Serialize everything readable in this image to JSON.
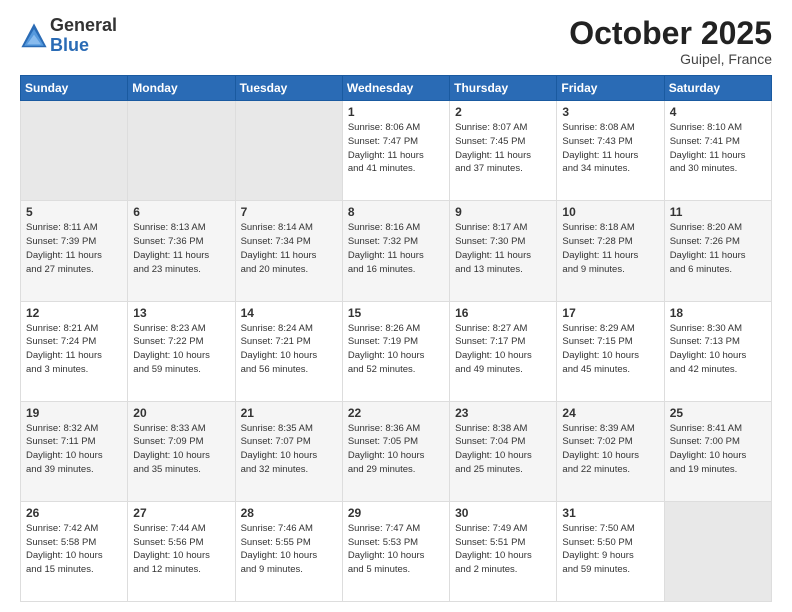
{
  "header": {
    "logo_general": "General",
    "logo_blue": "Blue",
    "month_title": "October 2025",
    "location": "Guipel, France"
  },
  "days_of_week": [
    "Sunday",
    "Monday",
    "Tuesday",
    "Wednesday",
    "Thursday",
    "Friday",
    "Saturday"
  ],
  "weeks": [
    [
      {
        "num": "",
        "info": ""
      },
      {
        "num": "",
        "info": ""
      },
      {
        "num": "",
        "info": ""
      },
      {
        "num": "1",
        "info": "Sunrise: 8:06 AM\nSunset: 7:47 PM\nDaylight: 11 hours\nand 41 minutes."
      },
      {
        "num": "2",
        "info": "Sunrise: 8:07 AM\nSunset: 7:45 PM\nDaylight: 11 hours\nand 37 minutes."
      },
      {
        "num": "3",
        "info": "Sunrise: 8:08 AM\nSunset: 7:43 PM\nDaylight: 11 hours\nand 34 minutes."
      },
      {
        "num": "4",
        "info": "Sunrise: 8:10 AM\nSunset: 7:41 PM\nDaylight: 11 hours\nand 30 minutes."
      }
    ],
    [
      {
        "num": "5",
        "info": "Sunrise: 8:11 AM\nSunset: 7:39 PM\nDaylight: 11 hours\nand 27 minutes."
      },
      {
        "num": "6",
        "info": "Sunrise: 8:13 AM\nSunset: 7:36 PM\nDaylight: 11 hours\nand 23 minutes."
      },
      {
        "num": "7",
        "info": "Sunrise: 8:14 AM\nSunset: 7:34 PM\nDaylight: 11 hours\nand 20 minutes."
      },
      {
        "num": "8",
        "info": "Sunrise: 8:16 AM\nSunset: 7:32 PM\nDaylight: 11 hours\nand 16 minutes."
      },
      {
        "num": "9",
        "info": "Sunrise: 8:17 AM\nSunset: 7:30 PM\nDaylight: 11 hours\nand 13 minutes."
      },
      {
        "num": "10",
        "info": "Sunrise: 8:18 AM\nSunset: 7:28 PM\nDaylight: 11 hours\nand 9 minutes."
      },
      {
        "num": "11",
        "info": "Sunrise: 8:20 AM\nSunset: 7:26 PM\nDaylight: 11 hours\nand 6 minutes."
      }
    ],
    [
      {
        "num": "12",
        "info": "Sunrise: 8:21 AM\nSunset: 7:24 PM\nDaylight: 11 hours\nand 3 minutes."
      },
      {
        "num": "13",
        "info": "Sunrise: 8:23 AM\nSunset: 7:22 PM\nDaylight: 10 hours\nand 59 minutes."
      },
      {
        "num": "14",
        "info": "Sunrise: 8:24 AM\nSunset: 7:21 PM\nDaylight: 10 hours\nand 56 minutes."
      },
      {
        "num": "15",
        "info": "Sunrise: 8:26 AM\nSunset: 7:19 PM\nDaylight: 10 hours\nand 52 minutes."
      },
      {
        "num": "16",
        "info": "Sunrise: 8:27 AM\nSunset: 7:17 PM\nDaylight: 10 hours\nand 49 minutes."
      },
      {
        "num": "17",
        "info": "Sunrise: 8:29 AM\nSunset: 7:15 PM\nDaylight: 10 hours\nand 45 minutes."
      },
      {
        "num": "18",
        "info": "Sunrise: 8:30 AM\nSunset: 7:13 PM\nDaylight: 10 hours\nand 42 minutes."
      }
    ],
    [
      {
        "num": "19",
        "info": "Sunrise: 8:32 AM\nSunset: 7:11 PM\nDaylight: 10 hours\nand 39 minutes."
      },
      {
        "num": "20",
        "info": "Sunrise: 8:33 AM\nSunset: 7:09 PM\nDaylight: 10 hours\nand 35 minutes."
      },
      {
        "num": "21",
        "info": "Sunrise: 8:35 AM\nSunset: 7:07 PM\nDaylight: 10 hours\nand 32 minutes."
      },
      {
        "num": "22",
        "info": "Sunrise: 8:36 AM\nSunset: 7:05 PM\nDaylight: 10 hours\nand 29 minutes."
      },
      {
        "num": "23",
        "info": "Sunrise: 8:38 AM\nSunset: 7:04 PM\nDaylight: 10 hours\nand 25 minutes."
      },
      {
        "num": "24",
        "info": "Sunrise: 8:39 AM\nSunset: 7:02 PM\nDaylight: 10 hours\nand 22 minutes."
      },
      {
        "num": "25",
        "info": "Sunrise: 8:41 AM\nSunset: 7:00 PM\nDaylight: 10 hours\nand 19 minutes."
      }
    ],
    [
      {
        "num": "26",
        "info": "Sunrise: 7:42 AM\nSunset: 5:58 PM\nDaylight: 10 hours\nand 15 minutes."
      },
      {
        "num": "27",
        "info": "Sunrise: 7:44 AM\nSunset: 5:56 PM\nDaylight: 10 hours\nand 12 minutes."
      },
      {
        "num": "28",
        "info": "Sunrise: 7:46 AM\nSunset: 5:55 PM\nDaylight: 10 hours\nand 9 minutes."
      },
      {
        "num": "29",
        "info": "Sunrise: 7:47 AM\nSunset: 5:53 PM\nDaylight: 10 hours\nand 5 minutes."
      },
      {
        "num": "30",
        "info": "Sunrise: 7:49 AM\nSunset: 5:51 PM\nDaylight: 10 hours\nand 2 minutes."
      },
      {
        "num": "31",
        "info": "Sunrise: 7:50 AM\nSunset: 5:50 PM\nDaylight: 9 hours\nand 59 minutes."
      },
      {
        "num": "",
        "info": ""
      }
    ]
  ]
}
